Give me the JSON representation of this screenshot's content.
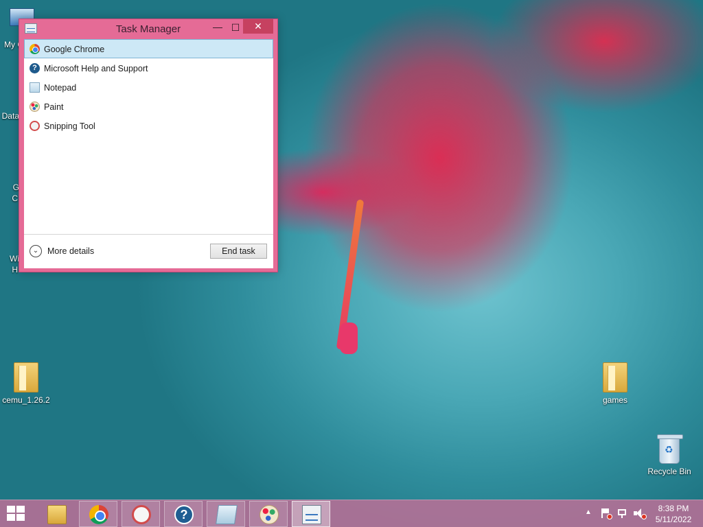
{
  "window": {
    "title": "Task Manager",
    "minimize_symbol": "—",
    "maximize_symbol": "☐",
    "close_symbol": "✕",
    "apps": [
      {
        "name": "Google Chrome",
        "icon": "chrome-icon",
        "selected": true
      },
      {
        "name": "Microsoft Help and Support",
        "icon": "help-icon",
        "selected": false
      },
      {
        "name": "Notepad",
        "icon": "notepad-icon",
        "selected": false
      },
      {
        "name": "Paint",
        "icon": "paint-icon",
        "selected": false
      },
      {
        "name": "Snipping Tool",
        "icon": "snipping-tool-icon",
        "selected": false
      }
    ],
    "more_details_label": "More details",
    "end_task_label": "End task",
    "accent_color": "#e56b96",
    "selection_color": "#cde8f6"
  },
  "desktop": {
    "icons": [
      {
        "label": "cemu_1.26.2",
        "icon": "folder-icon"
      },
      {
        "label": "games",
        "icon": "folder-icon"
      },
      {
        "label": "Recycle Bin",
        "icon": "recycle-bin-icon"
      }
    ],
    "partial_labels": [
      "My C",
      "Data",
      "G",
      "C",
      "Wi",
      "H"
    ]
  },
  "taskbar": {
    "pinned": [
      {
        "name": "file-explorer",
        "icon": "folder-icon",
        "active": false
      },
      {
        "name": "google-chrome",
        "icon": "chrome-icon",
        "active": false
      },
      {
        "name": "snipping-tool",
        "icon": "snipping-tool-icon",
        "active": false
      },
      {
        "name": "help-and-support",
        "icon": "help-icon",
        "active": false
      },
      {
        "name": "notepad",
        "icon": "notepad-icon",
        "active": false
      },
      {
        "name": "paint",
        "icon": "paint-icon",
        "active": false
      },
      {
        "name": "task-manager",
        "icon": "task-manager-icon",
        "active": true
      }
    ],
    "tray_arrow": "▲",
    "help_glyph": "?",
    "time": "8:38 PM",
    "date": "5/11/2022"
  }
}
